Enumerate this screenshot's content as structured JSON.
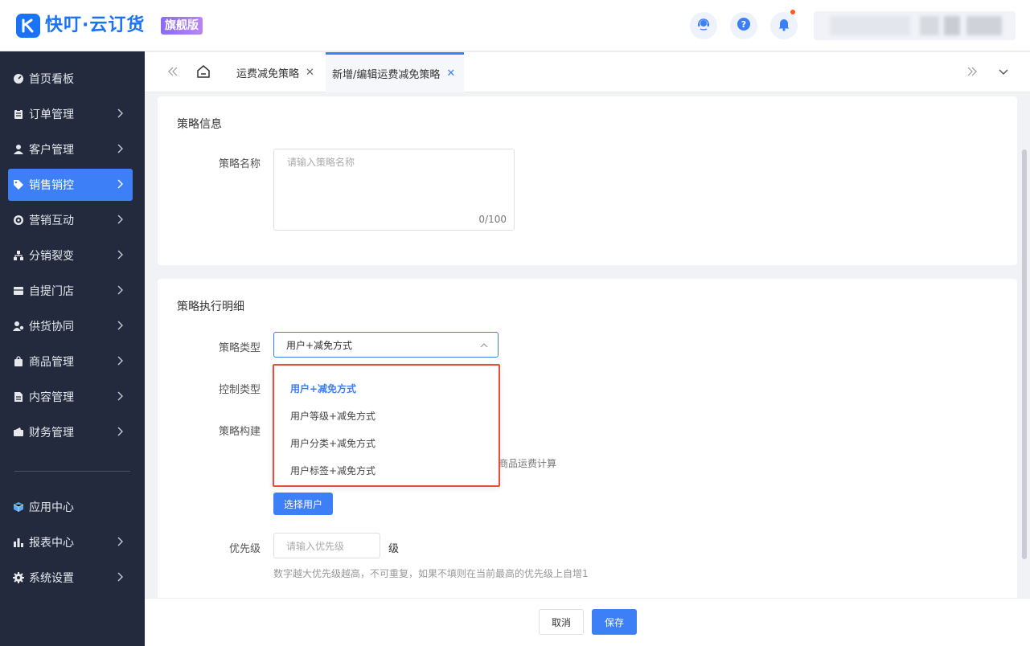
{
  "header": {
    "brand": "快叮·云订货",
    "edition": "旗舰版"
  },
  "sidebar": {
    "items": [
      {
        "label": "首页看板",
        "icon": "dashboard-icon"
      },
      {
        "label": "订单管理",
        "icon": "clipboard-icon"
      },
      {
        "label": "客户管理",
        "icon": "user-icon"
      },
      {
        "label": "销售销控",
        "icon": "tag-icon"
      },
      {
        "label": "营销互动",
        "icon": "target-icon"
      },
      {
        "label": "分销裂变",
        "icon": "network-icon"
      },
      {
        "label": "自提门店",
        "icon": "store-icon"
      },
      {
        "label": "供货协同",
        "icon": "supplier-icon"
      },
      {
        "label": "商品管理",
        "icon": "bag-icon"
      },
      {
        "label": "内容管理",
        "icon": "document-icon"
      },
      {
        "label": "财务管理",
        "icon": "wallet-icon"
      }
    ],
    "bottom_items": [
      {
        "label": "应用中心",
        "icon": "cube-icon"
      },
      {
        "label": "报表中心",
        "icon": "bar-chart-icon"
      },
      {
        "label": "系统设置",
        "icon": "gear-icon"
      }
    ]
  },
  "tabs": [
    {
      "label": "运费减免策略",
      "active": false
    },
    {
      "label": "新增/编辑运费减免策略",
      "active": true
    }
  ],
  "info_section": {
    "title": "策略信息",
    "name_label": "策略名称",
    "name_placeholder": "请输入策略名称",
    "counter": "0/100"
  },
  "detail_section": {
    "title": "策略执行明细",
    "type_label": "策略类型",
    "type_value": "用户+减免方式",
    "control_label": "控制类型",
    "build_label": "策略构建",
    "partial_hint": "按照商品运费计算",
    "select_user_button": "选择用户",
    "priority_label": "优先级",
    "priority_placeholder": "请输入优先级",
    "priority_unit": "级",
    "priority_hint": "数字越大优先级越高，不可重复，如果不填则在当前最高的优先级上自增1"
  },
  "dropdown": {
    "options": [
      "用户+减免方式",
      "用户等级+减免方式",
      "用户分类+减免方式",
      "用户标签+减免方式"
    ],
    "selected": "用户+减免方式"
  },
  "footer": {
    "cancel": "取消",
    "save": "保存"
  },
  "colors": {
    "accent": "#3d7ff6",
    "sidebar_bg": "#232a3d",
    "highlight_border": "#e84c3d"
  }
}
